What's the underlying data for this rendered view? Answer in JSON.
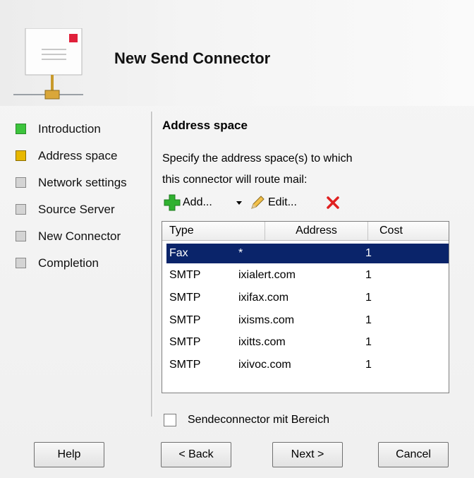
{
  "header": {
    "title": "New Send Connector",
    "icon": "mail-connector-icon"
  },
  "nav": {
    "items": [
      {
        "label": "Introduction",
        "state": "done",
        "color": "#3cc43c"
      },
      {
        "label": "Address space",
        "state": "current",
        "color": "#e8b800"
      },
      {
        "label": "Network settings",
        "state": "pending",
        "color": "#d4d4d4"
      },
      {
        "label": "Source Server",
        "state": "pending",
        "color": "#d4d4d4"
      },
      {
        "label": "New Connector",
        "state": "pending",
        "color": "#d4d4d4"
      },
      {
        "label": "Completion",
        "state": "pending",
        "color": "#d4d4d4"
      }
    ]
  },
  "page": {
    "section_title": "Address space",
    "description_line1": "Specify the address space(s) to which",
    "description_line2": "this connector will route mail:"
  },
  "toolbar": {
    "add_label": "Add...",
    "edit_label": "Edit...",
    "add_icon": "plus-icon",
    "edit_icon": "pencil-icon",
    "delete_icon": "delete-x-icon",
    "dropdown_icon": "dropdown-arrow-icon"
  },
  "grid": {
    "columns": [
      "Type",
      "Address",
      "Cost"
    ],
    "rows": [
      {
        "type": "Fax",
        "address": "*",
        "cost": "1",
        "selected": true
      },
      {
        "type": "SMTP",
        "address": "ixialert.com",
        "cost": "1"
      },
      {
        "type": "SMTP",
        "address": "ixifax.com",
        "cost": "1"
      },
      {
        "type": "SMTP",
        "address": "ixisms.com",
        "cost": "1"
      },
      {
        "type": "SMTP",
        "address": "ixitts.com",
        "cost": "1"
      },
      {
        "type": "SMTP",
        "address": "ixivoc.com",
        "cost": "1"
      }
    ]
  },
  "checkbox": {
    "label": "Sendeconnector mit Bereich",
    "checked": false
  },
  "buttons": {
    "help": "Help",
    "back": "< Back",
    "next": "Next >",
    "cancel": "Cancel"
  },
  "colors": {
    "selection": "#0a246a",
    "add_green": "#2fb12f",
    "delete_red": "#e02020"
  }
}
